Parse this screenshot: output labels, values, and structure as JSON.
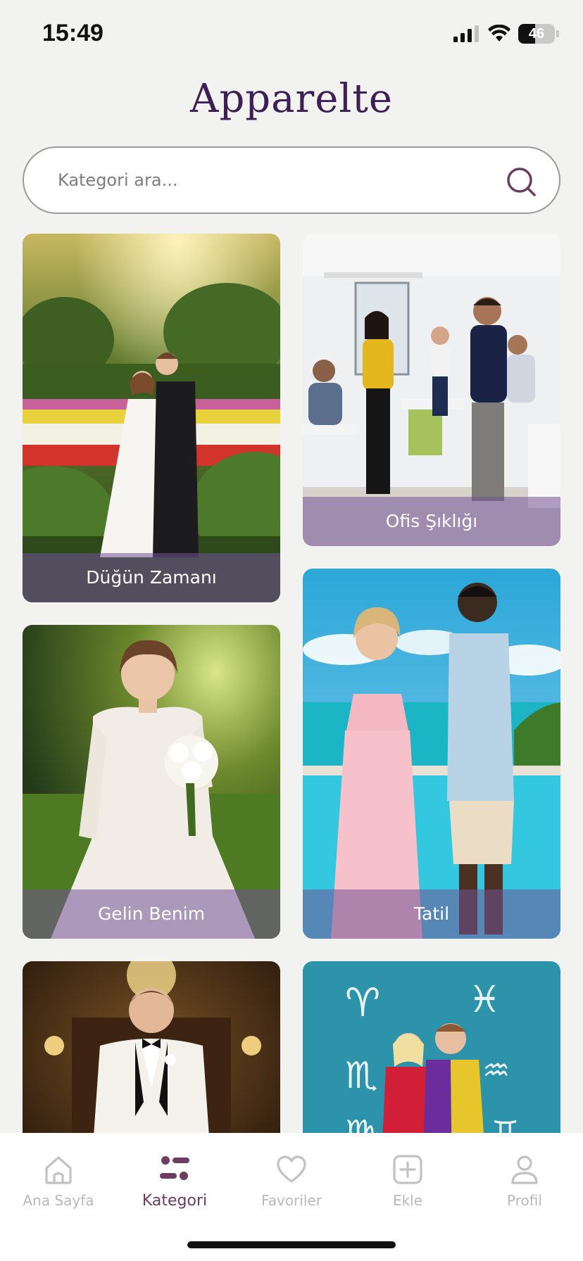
{
  "status_bar": {
    "time": "15:49",
    "battery": "46",
    "battery_level": 0.46
  },
  "app": {
    "logo": "Apparelte"
  },
  "search": {
    "placeholder": "Kategori ara..."
  },
  "categories": [
    {
      "label": "Düğün Zamanı",
      "image": "wedding-couple-garden"
    },
    {
      "label": "Ofis Şıklığı",
      "image": "office-team"
    },
    {
      "label": "Gelin Benim",
      "image": "bride-bouquet"
    },
    {
      "label": "Tatil",
      "image": "vacation-couple-sea"
    },
    {
      "label": "",
      "image": "groom-white-tuxedo"
    },
    {
      "label": "",
      "image": "zodiac-couple"
    }
  ],
  "nav": {
    "items": [
      {
        "label": "Ana Sayfa",
        "icon": "home-icon",
        "active": false
      },
      {
        "label": "Kategori",
        "icon": "category-icon",
        "active": true
      },
      {
        "label": "Favoriler",
        "icon": "heart-icon",
        "active": false
      },
      {
        "label": "Ekle",
        "icon": "add-icon",
        "active": false
      },
      {
        "label": "Profil",
        "icon": "profile-icon",
        "active": false
      }
    ]
  },
  "colors": {
    "brand": "#3d1f55",
    "active_nav": "#6e3b63",
    "inactive_nav": "#b9b9b9",
    "caption_overlay": "#7352969c"
  }
}
